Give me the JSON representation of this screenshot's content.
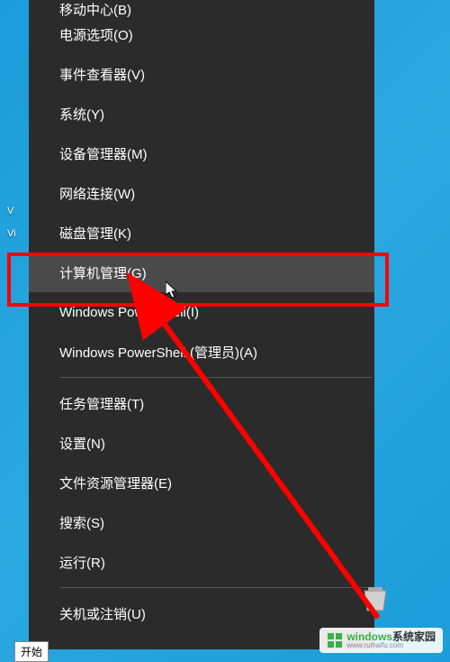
{
  "desktop": {
    "partial_text_1": "V",
    "partial_text_2": "Vi"
  },
  "menu": {
    "items": [
      "移动中心(B)",
      "电源选项(O)",
      "事件查看器(V)",
      "系统(Y)",
      "设备管理器(M)",
      "网络连接(W)",
      "磁盘管理(K)",
      "计算机管理(G)",
      "Windows PowerShell(I)",
      "Windows PowerShell (管理员)(A)",
      "任务管理器(T)",
      "设置(N)",
      "文件资源管理器(E)",
      "搜索(S)",
      "运行(R)",
      "关机或注销(U)"
    ],
    "highlighted_index": 7
  },
  "tooltip": {
    "text": "开始"
  },
  "watermark": {
    "brand_green": "windows",
    "brand_black": "系统家园",
    "url": "www.ruihaifu.com"
  }
}
